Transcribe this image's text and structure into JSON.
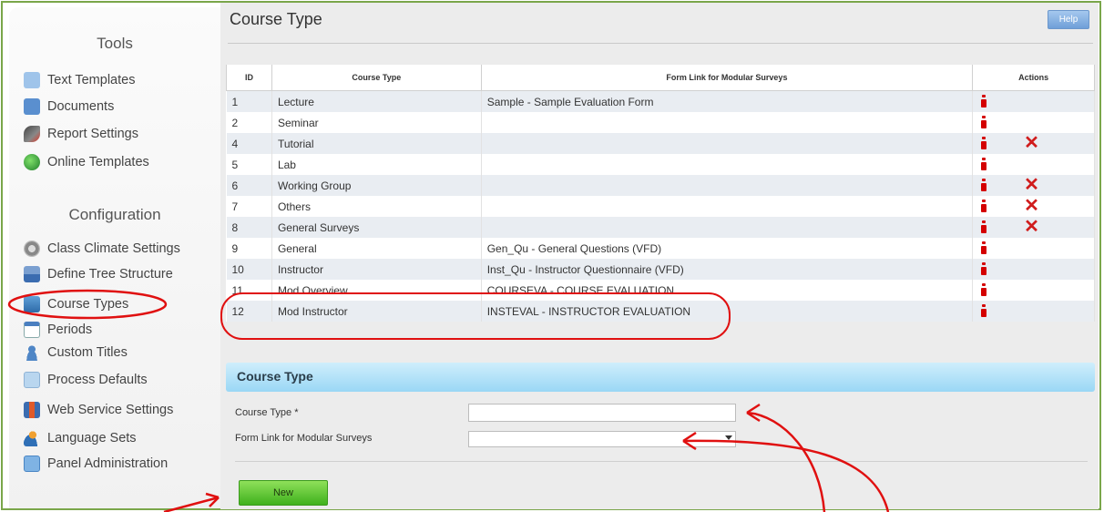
{
  "sidebar": {
    "tools_heading": "Tools",
    "tools": [
      {
        "label": "Text Templates",
        "icon": "text-template-icon"
      },
      {
        "label": "Documents",
        "icon": "documents-icon"
      },
      {
        "label": "Report Settings",
        "icon": "report-settings-icon"
      },
      {
        "label": "Online Templates",
        "icon": "online-templates-icon"
      }
    ],
    "config_heading": "Configuration",
    "config": [
      {
        "label": "Class Climate Settings",
        "icon": "gear-icon"
      },
      {
        "label": "Define Tree Structure",
        "icon": "tree-structure-icon"
      },
      {
        "label": "Course Types",
        "icon": "course-types-icon"
      },
      {
        "label": "Periods",
        "icon": "calendar-icon"
      },
      {
        "label": "Custom Titles",
        "icon": "user-icon"
      },
      {
        "label": "Process Defaults",
        "icon": "process-icon"
      },
      {
        "label": "Web Service Settings",
        "icon": "web-service-icon"
      },
      {
        "label": "Language Sets",
        "icon": "language-icon"
      },
      {
        "label": "Panel Administration",
        "icon": "panel-icon"
      }
    ]
  },
  "main": {
    "title": "Course Type",
    "help_label": "Help",
    "table": {
      "columns": [
        "ID",
        "Course Type",
        "Form Link for Modular Surveys",
        "Actions"
      ],
      "rows": [
        {
          "id": "1",
          "type": "Lecture",
          "form": "Sample - Sample Evaluation Form",
          "deletable": false
        },
        {
          "id": "2",
          "type": "Seminar",
          "form": "",
          "deletable": false
        },
        {
          "id": "4",
          "type": "Tutorial",
          "form": "",
          "deletable": true
        },
        {
          "id": "5",
          "type": "Lab",
          "form": "",
          "deletable": false
        },
        {
          "id": "6",
          "type": "Working Group",
          "form": "",
          "deletable": true
        },
        {
          "id": "7",
          "type": "Others",
          "form": "",
          "deletable": true
        },
        {
          "id": "8",
          "type": "General Surveys",
          "form": "",
          "deletable": true
        },
        {
          "id": "9",
          "type": "General",
          "form": "Gen_Qu - General Questions (VFD)",
          "deletable": false
        },
        {
          "id": "10",
          "type": "Instructor",
          "form": "Inst_Qu - Instructor Questionnaire (VFD)",
          "deletable": false
        },
        {
          "id": "11",
          "type": "Mod Overview",
          "form": "COURSEVA - COURSE EVALUATION",
          "deletable": false
        },
        {
          "id": "12",
          "type": "Mod Instructor",
          "form": "INSTEVAL - INSTRUCTOR EVALUATION",
          "deletable": false
        }
      ]
    },
    "form": {
      "heading": "Course Type",
      "course_type_label": "Course Type *",
      "course_type_value": "",
      "form_link_label": "Form Link for Modular Surveys",
      "form_link_value": "",
      "new_label": "New"
    }
  },
  "colors": {
    "annotation": "#e01010",
    "delete_x": "#d01c1c",
    "new_button": "#5cc233",
    "section_bar": "#9ad7f5",
    "frame": "#7aa64a"
  }
}
